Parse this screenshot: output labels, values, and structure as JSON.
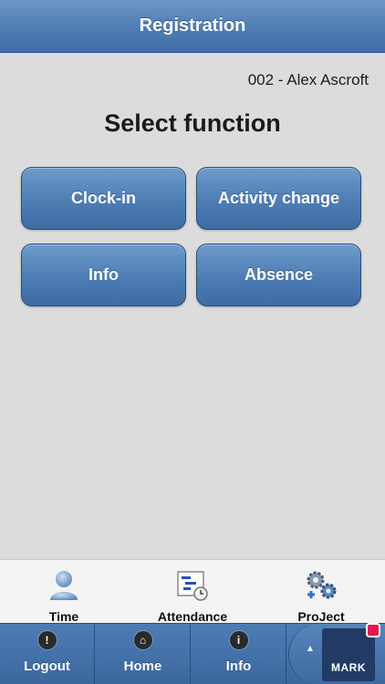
{
  "header": {
    "title": "Registration"
  },
  "user": {
    "label": "002 - Alex Ascroft"
  },
  "main": {
    "title": "Select function",
    "buttons": [
      {
        "label": "Clock-in"
      },
      {
        "label": "Activity change"
      },
      {
        "label": "Info"
      },
      {
        "label": "Absence"
      }
    ]
  },
  "tabs": [
    {
      "label": "Time",
      "icon": "person-icon"
    },
    {
      "label": "Attendance",
      "icon": "attendance-chart-icon"
    },
    {
      "label": "ProJect",
      "icon": "gears-icon"
    }
  ],
  "bottom_bar": [
    {
      "label": "Logout",
      "icon": "warning-icon",
      "glyph": "!"
    },
    {
      "label": "Home",
      "icon": "home-icon",
      "glyph": "⌂"
    },
    {
      "label": "Info",
      "icon": "info-icon",
      "glyph": "i"
    }
  ],
  "logo": {
    "text": "MARK"
  },
  "colors": {
    "accent": "#4e7db3",
    "bar": "#3a679e",
    "logo_bg": "#213a66",
    "logo_dot": "#e4184f"
  }
}
